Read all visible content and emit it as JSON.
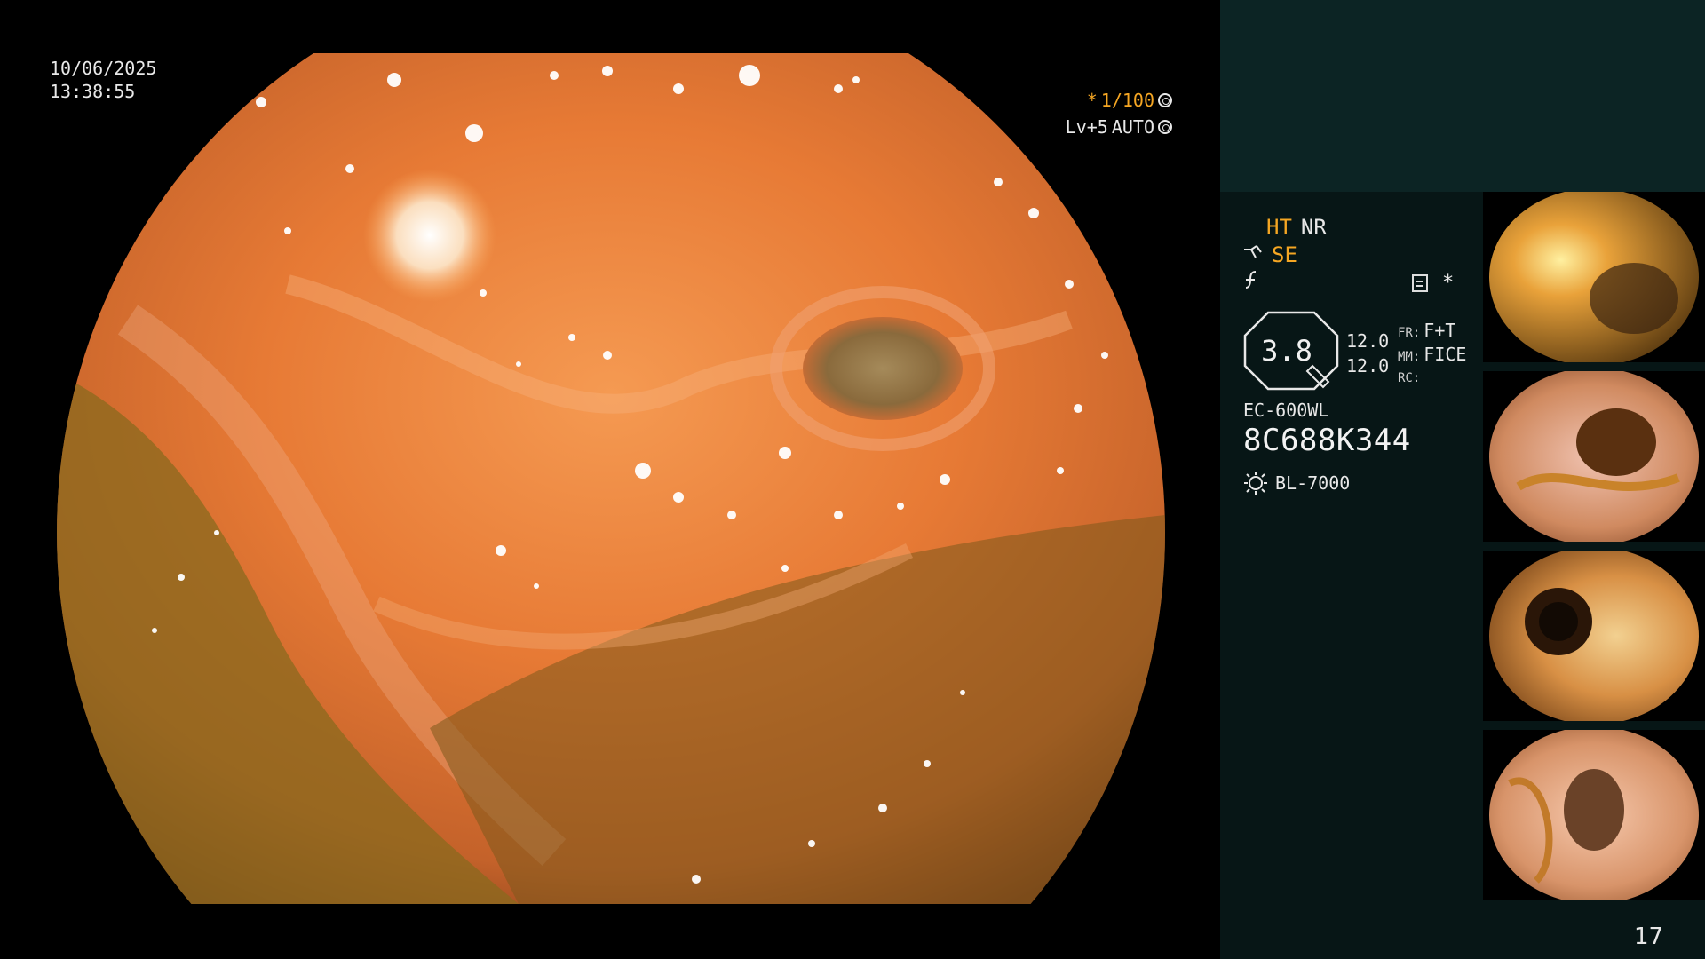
{
  "overlay": {
    "date": "10/06/2025",
    "time": "13:38:55",
    "shutter_prefix": "*",
    "shutter": "1/100",
    "level": "Lv+5",
    "auto": "AUTO"
  },
  "panel": {
    "mode_ht": "HT",
    "mode_nr": "NR",
    "mode_se": "SE",
    "star": "*",
    "gauge_value": "3.8",
    "gauge_top": "12.0",
    "gauge_bottom": "12.0",
    "fr_label": "FR:",
    "fr_value": "F+T",
    "mm_label": "MM:",
    "mm_value": "FICE",
    "rc_label": "RC:",
    "rc_value": "",
    "scope_model": "EC-600WL",
    "serial": "8C688K344",
    "light_source": "BL-7000"
  },
  "page_number": "17",
  "icons": [
    "shutter-wheel-icon",
    "auto-gear-icon",
    "scope-icon",
    "flash-icon",
    "document-icon",
    "star-icon",
    "light-source-icon"
  ],
  "colors": {
    "accent": "#f5a623",
    "panel_bg": "#071616",
    "panel_top_bg": "#0c2424"
  }
}
